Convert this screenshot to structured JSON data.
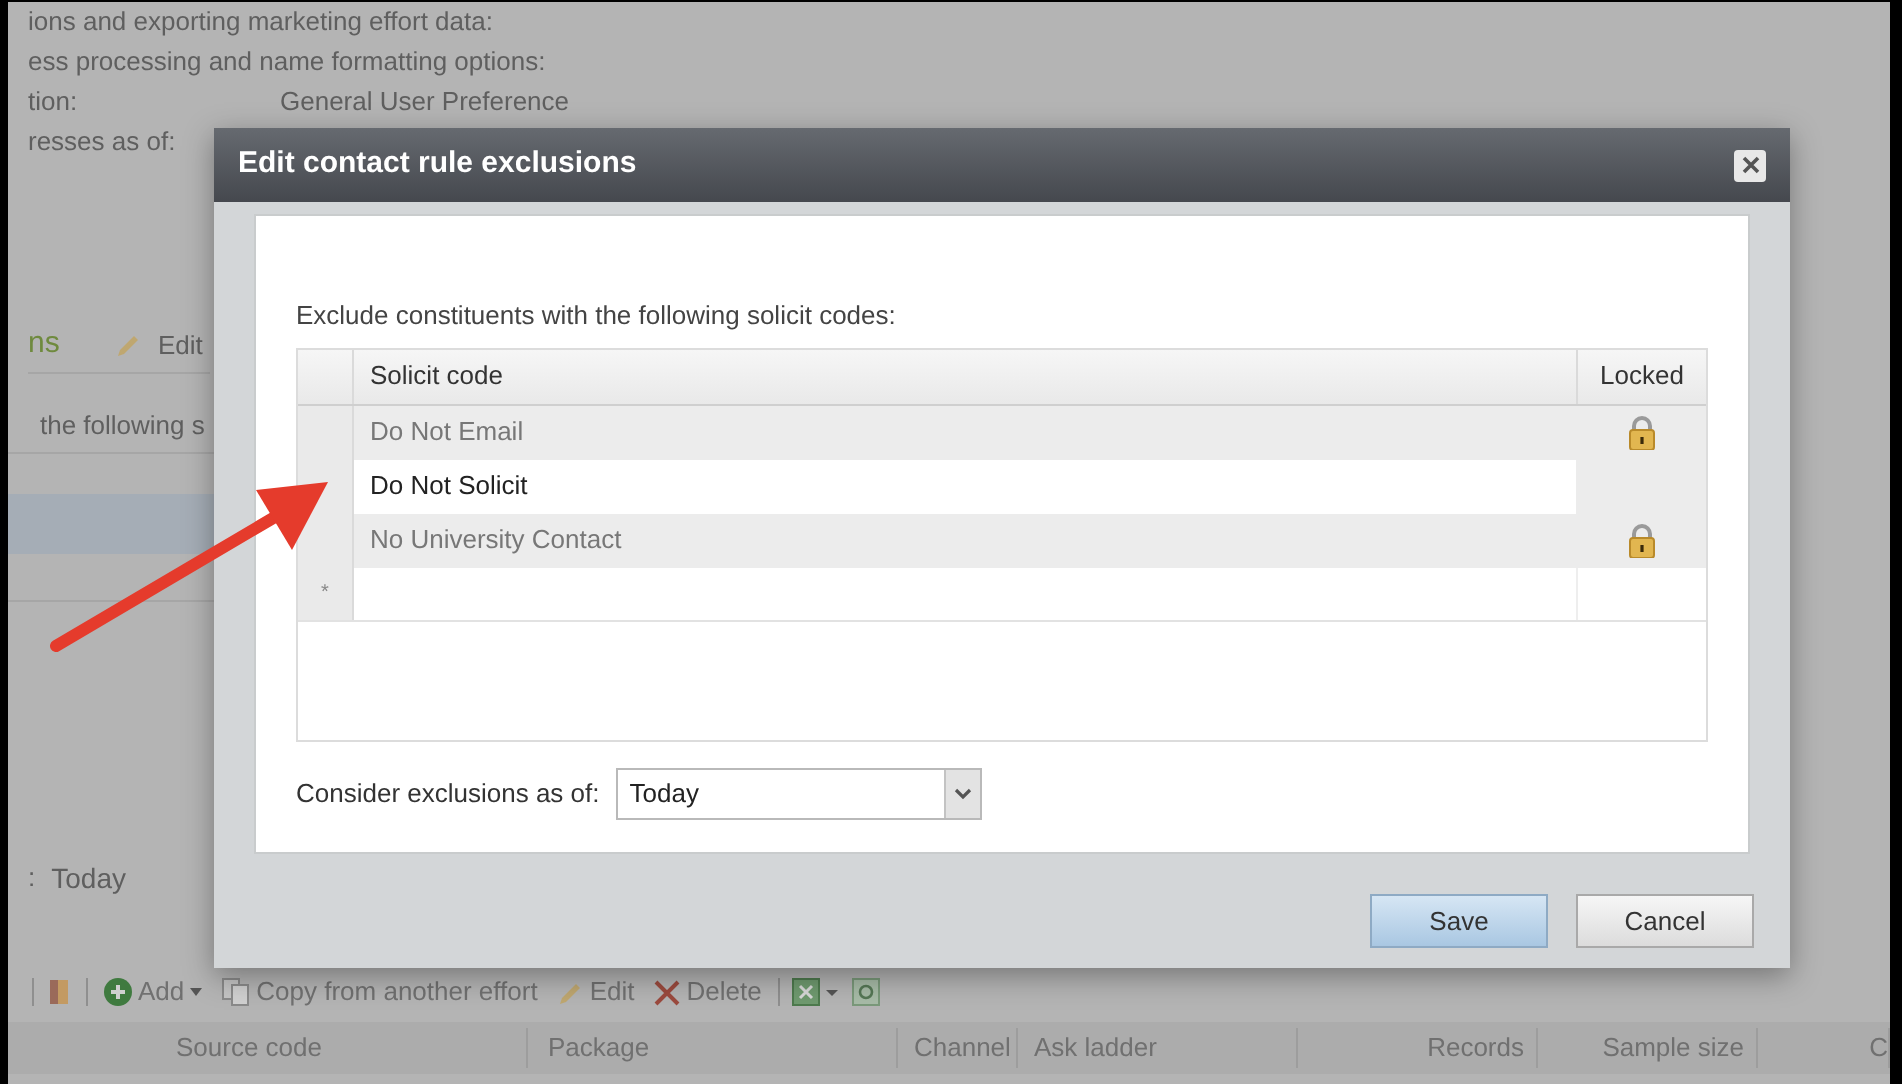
{
  "background_page": {
    "lines": [
      {
        "label": "ions and exporting marketing effort data:"
      },
      {
        "label": "ess processing and name formatting options:"
      },
      {
        "label": "tion:",
        "value": "General User Preference"
      },
      {
        "label": "resses as of:"
      }
    ],
    "section_title": "ns",
    "edit_link": "Edit",
    "grid_text": "the following s",
    "as_of": {
      "label": ":",
      "value": "Today"
    },
    "toolbar": [
      {
        "label": "Add",
        "kind": "add"
      },
      {
        "label": "Copy from another effort",
        "kind": "copy"
      },
      {
        "label": "Edit",
        "kind": "edit"
      },
      {
        "label": "Delete",
        "kind": "delete"
      }
    ],
    "columns": [
      "Source code",
      "Package",
      "Channel",
      "Ask ladder",
      "Records",
      "Sample size",
      "C"
    ]
  },
  "dialog": {
    "title": "Edit contact rule exclusions",
    "instruction": "Exclude constituents with the following solicit codes:",
    "table": {
      "columns": [
        "Solicit code",
        "Locked"
      ],
      "rows": [
        {
          "code": "Do Not Email",
          "locked": true
        },
        {
          "code": "Do Not Solicit",
          "locked": false
        },
        {
          "code": "No University Contact",
          "locked": true
        }
      ],
      "new_row_marker": "*"
    },
    "as_of": {
      "label": "Consider exclusions as of:",
      "value": "Today"
    },
    "buttons": [
      {
        "label": "Save",
        "kind": "primary"
      },
      {
        "label": "Cancel",
        "kind": "secondary"
      }
    ]
  }
}
